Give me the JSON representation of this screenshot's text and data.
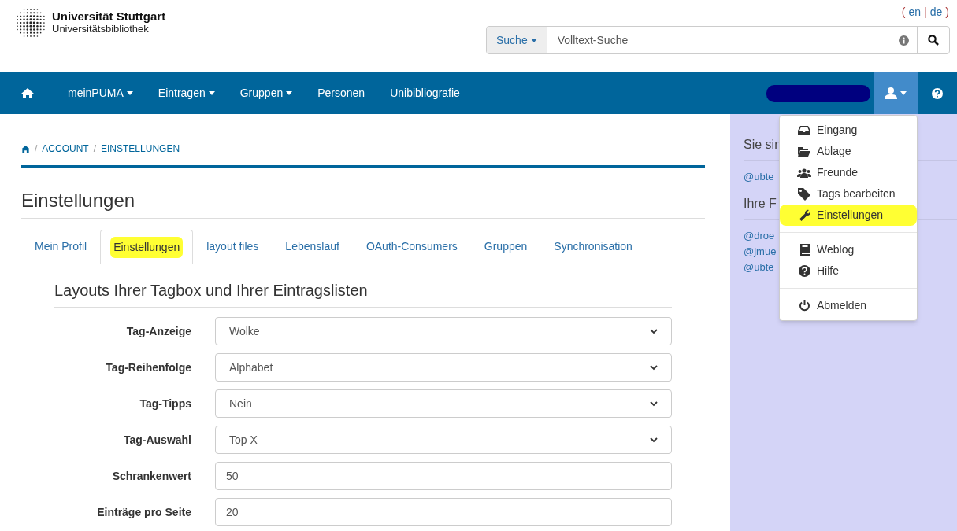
{
  "header": {
    "logo_title": "Universität Stuttgart",
    "logo_subtitle": "Universitätsbibliothek",
    "languages": {
      "open": "(",
      "items": [
        "en",
        "de"
      ],
      "separator": "|",
      "close": ")"
    },
    "search": {
      "scope": "Suche",
      "placeholder": "Volltext-Suche"
    }
  },
  "navbar": {
    "items": [
      {
        "label": "meinPUMA",
        "dropdown": true
      },
      {
        "label": "Eintragen",
        "dropdown": true
      },
      {
        "label": "Gruppen",
        "dropdown": true
      },
      {
        "label": "Personen",
        "dropdown": false
      },
      {
        "label": "Unibibliografie",
        "dropdown": false
      }
    ],
    "user_menu_open": true
  },
  "breadcrumb": {
    "separator": "/",
    "items": [
      "ACCOUNT",
      "EINSTELLUNGEN"
    ]
  },
  "page_title": "Einstellungen",
  "tabs": [
    {
      "label": "Mein Profil",
      "selected": false,
      "highlighted": false
    },
    {
      "label": "Einstellungen",
      "selected": true,
      "highlighted": true
    },
    {
      "label": "layout files",
      "selected": false,
      "highlighted": false
    },
    {
      "label": "Lebenslauf",
      "selected": false,
      "highlighted": false
    },
    {
      "label": "OAuth-Consumers",
      "selected": false,
      "highlighted": false
    },
    {
      "label": "Gruppen",
      "selected": false,
      "highlighted": false
    },
    {
      "label": "Synchronisation",
      "selected": false,
      "highlighted": false
    }
  ],
  "section_title": "Layouts Ihrer Tagbox und Ihrer Eintragslisten",
  "fields": [
    {
      "label": "Tag-Anzeige",
      "kind": "select",
      "value": "Wolke"
    },
    {
      "label": "Tag-Reihenfolge",
      "kind": "select",
      "value": "Alphabet"
    },
    {
      "label": "Tag-Tipps",
      "kind": "select",
      "value": "Nein"
    },
    {
      "label": "Tag-Auswahl",
      "kind": "select",
      "value": "Top X"
    },
    {
      "label": "Schrankenwert",
      "kind": "text",
      "value": "50"
    },
    {
      "label": "Einträge pro Seite",
      "kind": "text",
      "value": "20"
    }
  ],
  "sidebar": {
    "sections": [
      {
        "title": "Sie sin",
        "links": [
          "@ubte"
        ]
      },
      {
        "title": "Ihre F",
        "links": [
          "@droe",
          "@jmue",
          "@ubte"
        ]
      }
    ]
  },
  "user_menu": [
    {
      "kind": "inbox",
      "label": "Eingang",
      "highlighted": false
    },
    {
      "kind": "folder",
      "label": "Ablage",
      "highlighted": false
    },
    {
      "kind": "users",
      "label": "Freunde",
      "highlighted": false
    },
    {
      "kind": "tag",
      "label": "Tags bearbeiten",
      "highlighted": false
    },
    {
      "kind": "wrench",
      "label": "Einstellungen",
      "highlighted": true
    },
    {
      "kind": "divider"
    },
    {
      "kind": "book",
      "label": "Weblog",
      "highlighted": false
    },
    {
      "kind": "help",
      "label": "Hilfe",
      "highlighted": false
    },
    {
      "kind": "divider"
    },
    {
      "kind": "power",
      "label": "Abmelden",
      "highlighted": false
    }
  ]
}
